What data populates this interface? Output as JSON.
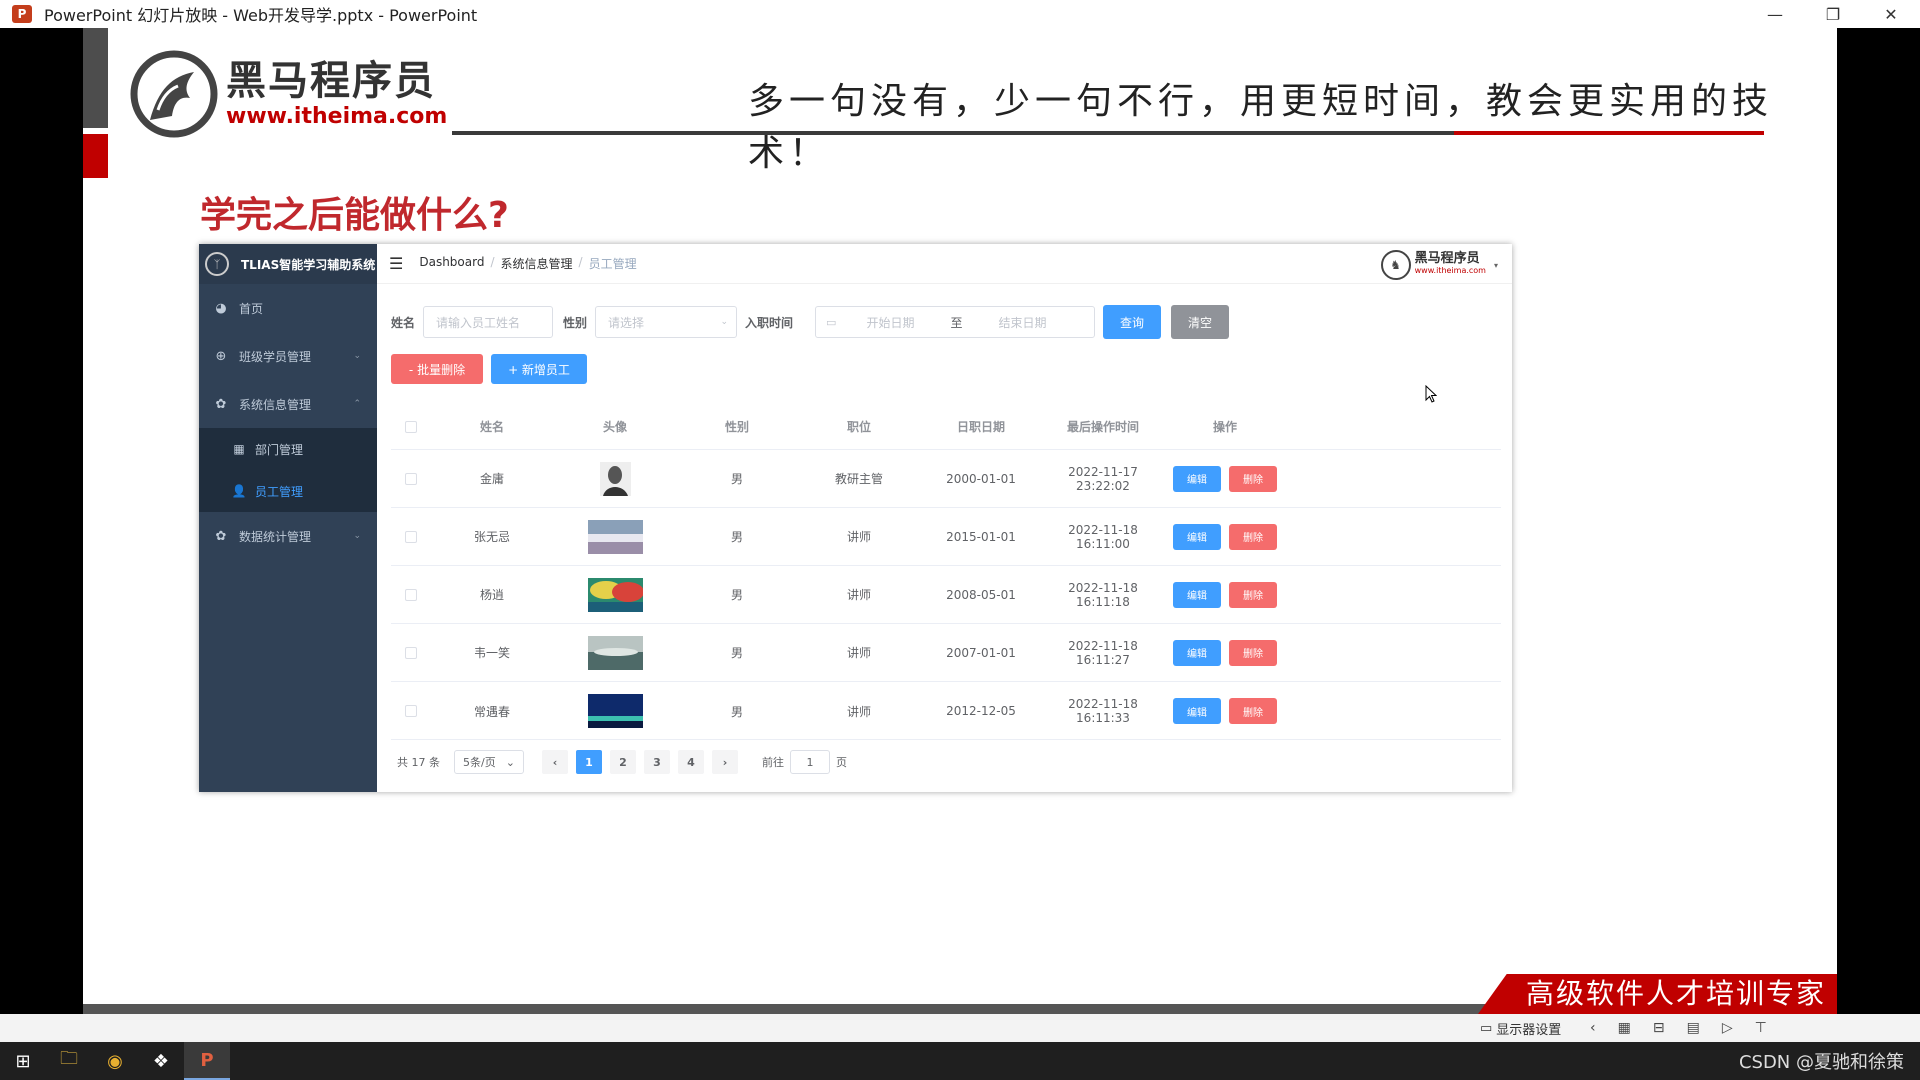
{
  "window": {
    "title": "PowerPoint 幻灯片放映  -  Web开发导学.pptx  -  PowerPoint",
    "app_icon": "P",
    "controls": [
      "—",
      "❐",
      "✕"
    ]
  },
  "slide": {
    "logo_cn": "黑马程序员",
    "logo_url": "www.itheima.com",
    "slogan": "多一句没有，少一句不行，用更短时间，教会更实用的技术！",
    "heading": "学完之后能做什么?",
    "banner": "高级软件人才培训专家"
  },
  "app": {
    "brand": "TLIAS智能学习辅助系统",
    "brand_logo": "ᛉ",
    "menu": [
      {
        "label": "首页",
        "icon": "dashboard-icon",
        "glyph": "◕"
      },
      {
        "label": "班级学员管理",
        "icon": "plus-circle-icon",
        "glyph": "⊕",
        "arrow": "⌄"
      },
      {
        "label": "系统信息管理",
        "icon": "gear-icon",
        "glyph": "✿",
        "arrow": "⌃"
      }
    ],
    "submenu": [
      {
        "label": "部门管理",
        "icon": "grid-icon",
        "glyph": "▦"
      },
      {
        "label": "员工管理",
        "icon": "user-icon",
        "glyph": "👤"
      }
    ],
    "menu_last": {
      "label": "数据统计管理",
      "icon": "gear-icon",
      "glyph": "✿",
      "arrow": "⌄"
    },
    "breadcrumb": [
      "Dashboard",
      "系统信息管理",
      "员工管理"
    ],
    "breadcrumb_sep": "/",
    "hamburger": "☰",
    "top_logo_cn": "黑马程序员",
    "top_logo_url": "www.itheima.com",
    "top_logo_caret": "▾",
    "search": {
      "name_label": "姓名",
      "name_placeholder": "请输入员工姓名",
      "gender_label": "性别",
      "gender_placeholder": "请选择",
      "gender_caret": "⌄",
      "date_label": "入职时间",
      "date_icon": "▭",
      "date_start": "开始日期",
      "date_to": "至",
      "date_end": "结束日期",
      "query": "查询",
      "clear": "清空"
    },
    "actions": {
      "batch_delete": "- 批量删除",
      "add": "+ 新增员工"
    },
    "table": {
      "headers": [
        "姓名",
        "头像",
        "性别",
        "职位",
        "日职日期",
        "最后操作时间",
        "操作"
      ],
      "rows": [
        {
          "name": "金庸",
          "gender": "男",
          "job": "教研主管",
          "entry": "2000-01-01",
          "update": "2022-11-17 23:22:02"
        },
        {
          "name": "张无忌",
          "gender": "男",
          "job": "讲师",
          "entry": "2015-01-01",
          "update": "2022-11-18 16:11:00"
        },
        {
          "name": "杨逍",
          "gender": "男",
          "job": "讲师",
          "entry": "2008-05-01",
          "update": "2022-11-18 16:11:18"
        },
        {
          "name": "韦一笑",
          "gender": "男",
          "job": "讲师",
          "entry": "2007-01-01",
          "update": "2022-11-18 16:11:27"
        },
        {
          "name": "常遇春",
          "gender": "男",
          "job": "讲师",
          "entry": "2012-12-05",
          "update": "2022-11-18 16:11:33"
        }
      ],
      "edit": "编辑",
      "delete": "删除"
    },
    "pager": {
      "total": "共 17 条",
      "size": "5条/页",
      "size_caret": "⌄",
      "prev": "‹",
      "pages": [
        "1",
        "2",
        "3",
        "4"
      ],
      "next": "›",
      "goto_prefix": "前往",
      "goto_value": "1",
      "goto_suffix": "页"
    }
  },
  "status": {
    "display_settings": "显示器设置",
    "icons": [
      "‹",
      "▦",
      "⊟",
      "▤",
      "▷",
      "⊤"
    ]
  },
  "taskbar": {
    "apps": [
      "⊞",
      "🗀",
      "◉",
      "❖",
      "P"
    ],
    "watermark": "CSDN @夏驰和徐策"
  },
  "colors": {
    "primary": "#409eff",
    "danger": "#f56c6c",
    "info": "#909399",
    "sidebar": "#304156",
    "brand_red": "#c00000"
  }
}
